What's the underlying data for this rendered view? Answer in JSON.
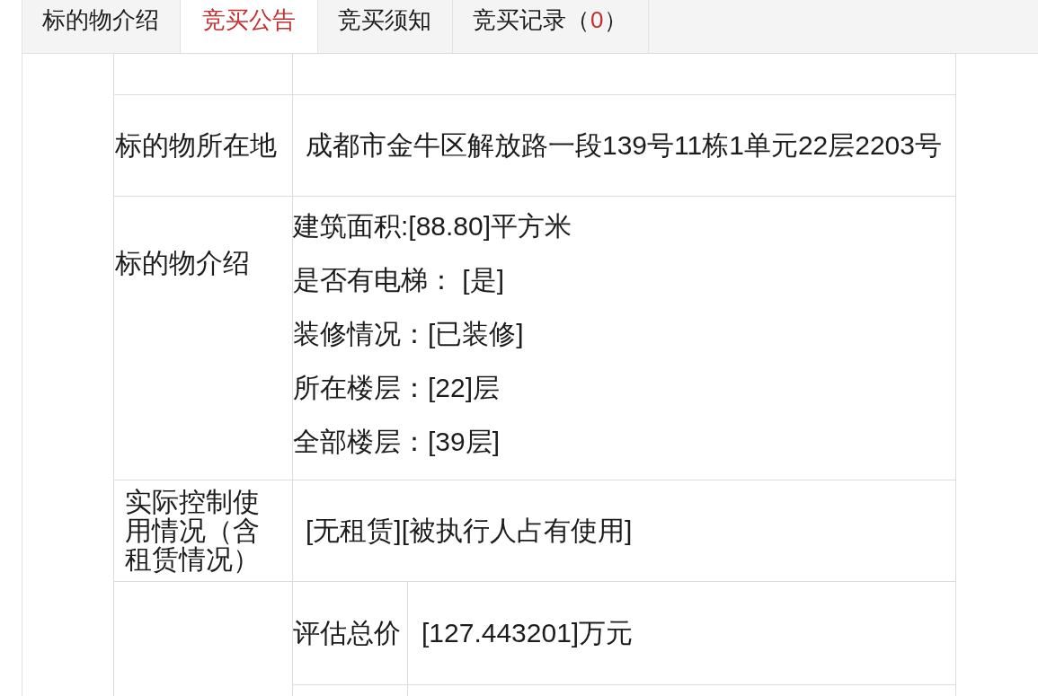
{
  "tabs": [
    {
      "label": "标的物介绍",
      "selected": false
    },
    {
      "label": "竞买公告",
      "selected": true
    },
    {
      "label": "竞买须知",
      "selected": false
    },
    {
      "label": "竞买记录",
      "count": {
        "open": "（",
        "value": "0",
        "close": "）"
      },
      "selected": false
    }
  ],
  "table": {
    "rows": [
      {
        "kind": "empty"
      },
      {
        "kind": "plain",
        "label": "标的物所在地",
        "value": "成都市金牛区解放路一段139号11栋1单元22层2203号"
      },
      {
        "kind": "list",
        "label": "标的物介绍",
        "lines": [
          "建筑面积:[88.80]平方米",
          "是否有电梯： [是]",
          "装修情况：[已装修]",
          "所在楼层：[22]层",
          "全部楼层：[39层]"
        ]
      },
      {
        "kind": "padded",
        "label": "实际控制使用情况（含租赁情况）",
        "value": "[无租赁][被执行人占有使用]"
      },
      {
        "kind": "nested",
        "subrows": [
          {
            "kind": "filled",
            "label": "评估总价",
            "value": "[127.443201]万元"
          },
          {
            "kind": "empty"
          }
        ]
      }
    ]
  }
}
